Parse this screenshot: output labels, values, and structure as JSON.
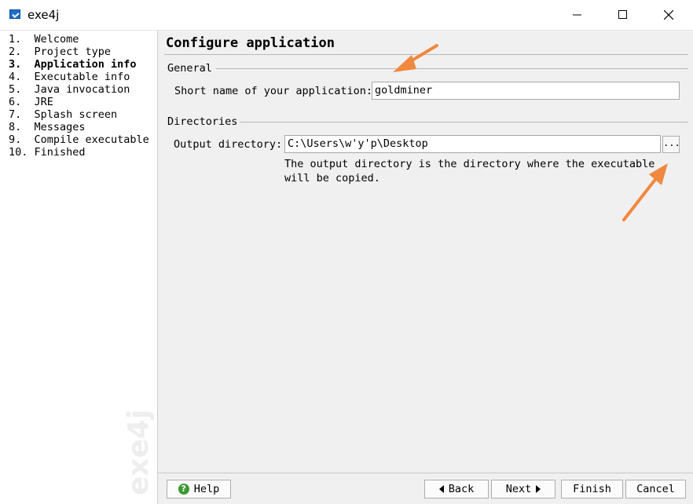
{
  "window": {
    "title": "exe4j"
  },
  "sidebar": {
    "steps": [
      {
        "label": "1.  Welcome",
        "active": false
      },
      {
        "label": "2.  Project type",
        "active": false
      },
      {
        "label": "3.  Application info",
        "active": true
      },
      {
        "label": "4.  Executable info",
        "active": false
      },
      {
        "label": "5.  Java invocation",
        "active": false
      },
      {
        "label": "6.  JRE",
        "active": false
      },
      {
        "label": "7.  Splash screen",
        "active": false
      },
      {
        "label": "8.  Messages",
        "active": false
      },
      {
        "label": "9.  Compile executable",
        "active": false
      },
      {
        "label": "10. Finished",
        "active": false
      }
    ],
    "watermark": "exe4j"
  },
  "main": {
    "heading": "Configure application",
    "general": {
      "section_label": "General",
      "short_name_label": "Short name of your application:",
      "short_name_value": "goldminer"
    },
    "directories": {
      "section_label": "Directories",
      "output_label": "Output directory:",
      "output_value": "C:\\Users\\w'y'p\\Desktop",
      "browse_label": "...",
      "description_line1": "The output directory is the directory where the executable",
      "description_line2": "will be copied."
    }
  },
  "footer": {
    "help_label": "Help",
    "back_label": "Back",
    "next_label": "Next",
    "finish_label": "Finish",
    "cancel_label": "Cancel"
  },
  "colors": {
    "annotation_arrow": "#f0883e",
    "help_icon": "#3c9a32"
  }
}
